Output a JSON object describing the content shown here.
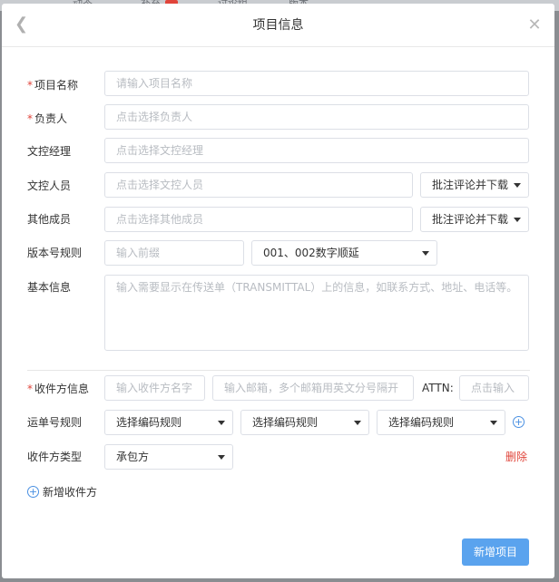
{
  "background": {
    "tabs": [
      "动态",
      "补充",
      "讨论组",
      "版本"
    ],
    "badge_color": "#e0443a"
  },
  "dialog": {
    "title": "项目信息",
    "submit_label": "新增项目"
  },
  "form": {
    "project_name": {
      "label": "项目名称",
      "placeholder": "请输入项目名称",
      "required": true
    },
    "owner": {
      "label": "负责人",
      "placeholder": "点击选择负责人",
      "required": true
    },
    "doc_manager": {
      "label": "文控经理",
      "placeholder": "点击选择文控经理"
    },
    "doc_staff": {
      "label": "文控人员",
      "placeholder": "点击选择文控人员",
      "permission": "批注评论并下载"
    },
    "other_members": {
      "label": "其他成员",
      "placeholder": "点击选择其他成员",
      "permission": "批注评论并下载"
    },
    "version_rule": {
      "label": "版本号规则",
      "prefix_placeholder": "输入前缀",
      "scheme": "001、002数字顺延"
    },
    "basic_info": {
      "label": "基本信息",
      "placeholder": "输入需要显示在传送单（TRANSMITTAL）上的信息，如联系方式、地址、电话等。"
    },
    "recipient": {
      "label": "收件方信息",
      "name_placeholder": "输入收件方名字",
      "email_placeholder": "输入邮箱，多个邮箱用英文分号隔开",
      "attn_label": "ATTN:",
      "attn_placeholder": "点击输入"
    },
    "waybill_rule": {
      "label": "运单号规则",
      "options": [
        "选择编码规则",
        "选择编码规则",
        "选择编码规则"
      ]
    },
    "recipient_type": {
      "label": "收件方类型",
      "value": "承包方",
      "delete_label": "删除"
    },
    "add_recipient_label": "新增收件方"
  },
  "colors": {
    "accent": "#5aa3ee",
    "danger": "#e0443a",
    "link_icon": "#4a90e2"
  }
}
